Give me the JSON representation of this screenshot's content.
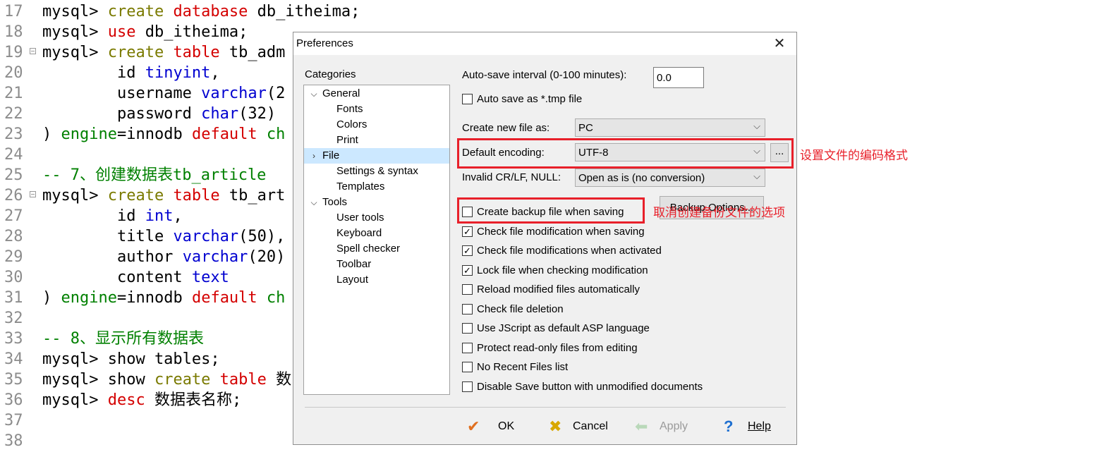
{
  "editor": {
    "lines": [
      {
        "n": "17",
        "fold": false,
        "tokens": [
          [
            "plain",
            "mysql> "
          ],
          [
            "kw2",
            "create "
          ],
          [
            "kw",
            "database "
          ],
          [
            "plain",
            "db_itheima;"
          ]
        ]
      },
      {
        "n": "18",
        "fold": false,
        "tokens": [
          [
            "plain",
            "mysql> "
          ],
          [
            "kw",
            "use "
          ],
          [
            "plain",
            "db_itheima;"
          ]
        ]
      },
      {
        "n": "19",
        "fold": true,
        "tokens": [
          [
            "plain",
            "mysql> "
          ],
          [
            "kw2",
            "create "
          ],
          [
            "kw",
            "table "
          ],
          [
            "plain",
            "tb_adm"
          ]
        ]
      },
      {
        "n": "20",
        "fold": false,
        "tokens": [
          [
            "plain",
            "        id "
          ],
          [
            "type",
            "tinyint"
          ],
          [
            "plain",
            ","
          ]
        ]
      },
      {
        "n": "21",
        "fold": false,
        "tokens": [
          [
            "plain",
            "        username "
          ],
          [
            "type",
            "varchar"
          ],
          [
            "plain",
            "(2"
          ]
        ]
      },
      {
        "n": "22",
        "fold": false,
        "tokens": [
          [
            "plain",
            "        password "
          ],
          [
            "type",
            "char"
          ],
          [
            "plain",
            "(32)"
          ]
        ]
      },
      {
        "n": "23",
        "fold": false,
        "tokens": [
          [
            "plain",
            ") "
          ],
          [
            "cm",
            "engine"
          ],
          [
            "plain",
            "=innodb "
          ],
          [
            "kw",
            "default "
          ],
          [
            "cm",
            "ch"
          ]
        ]
      },
      {
        "n": "24",
        "fold": false,
        "tokens": []
      },
      {
        "n": "25",
        "fold": false,
        "tokens": [
          [
            "cm",
            "-- 7、创建数据表tb_article"
          ]
        ]
      },
      {
        "n": "26",
        "fold": true,
        "tokens": [
          [
            "plain",
            "mysql> "
          ],
          [
            "kw2",
            "create "
          ],
          [
            "kw",
            "table "
          ],
          [
            "plain",
            "tb_art"
          ]
        ]
      },
      {
        "n": "27",
        "fold": false,
        "tokens": [
          [
            "plain",
            "        id "
          ],
          [
            "type",
            "int"
          ],
          [
            "plain",
            ","
          ]
        ]
      },
      {
        "n": "28",
        "fold": false,
        "tokens": [
          [
            "plain",
            "        title "
          ],
          [
            "type",
            "varchar"
          ],
          [
            "plain",
            "(50),"
          ]
        ]
      },
      {
        "n": "29",
        "fold": false,
        "tokens": [
          [
            "plain",
            "        author "
          ],
          [
            "type",
            "varchar"
          ],
          [
            "plain",
            "(20)"
          ]
        ]
      },
      {
        "n": "30",
        "fold": false,
        "tokens": [
          [
            "plain",
            "        content "
          ],
          [
            "type",
            "text"
          ]
        ]
      },
      {
        "n": "31",
        "fold": false,
        "tokens": [
          [
            "plain",
            ") "
          ],
          [
            "cm",
            "engine"
          ],
          [
            "plain",
            "=innodb "
          ],
          [
            "kw",
            "default "
          ],
          [
            "cm",
            "ch"
          ]
        ]
      },
      {
        "n": "32",
        "fold": false,
        "tokens": []
      },
      {
        "n": "33",
        "fold": false,
        "tokens": [
          [
            "cm",
            "-- 8、显示所有数据表"
          ]
        ]
      },
      {
        "n": "34",
        "fold": false,
        "tokens": [
          [
            "plain",
            "mysql> show tables;"
          ]
        ]
      },
      {
        "n": "35",
        "fold": false,
        "tokens": [
          [
            "plain",
            "mysql> show "
          ],
          [
            "kw2",
            "create "
          ],
          [
            "kw",
            "table "
          ],
          [
            "plain",
            "数"
          ]
        ]
      },
      {
        "n": "36",
        "fold": false,
        "tokens": [
          [
            "plain",
            "mysql> "
          ],
          [
            "kw",
            "desc "
          ],
          [
            "plain",
            "数据表名称;"
          ]
        ]
      },
      {
        "n": "37",
        "fold": false,
        "tokens": []
      },
      {
        "n": "38",
        "fold": false,
        "tokens": []
      }
    ]
  },
  "dialog": {
    "title": "Preferences",
    "close_glyph": "✕",
    "categories_label": "Categories",
    "tree": [
      {
        "label": "General",
        "level": 0,
        "expanded": true,
        "selected": false
      },
      {
        "label": "Fonts",
        "level": 1,
        "selected": false
      },
      {
        "label": "Colors",
        "level": 1,
        "selected": false
      },
      {
        "label": "Print",
        "level": 1,
        "selected": false
      },
      {
        "label": "File",
        "level": 0,
        "expanded": false,
        "selected": true
      },
      {
        "label": "Settings & syntax",
        "level": 1,
        "selected": false
      },
      {
        "label": "Templates",
        "level": 1,
        "selected": false
      },
      {
        "label": "Tools",
        "level": 0,
        "expanded": true,
        "selected": false
      },
      {
        "label": "User tools",
        "level": 1,
        "selected": false
      },
      {
        "label": "Keyboard",
        "level": 1,
        "selected": false
      },
      {
        "label": "Spell checker",
        "level": 1,
        "selected": false
      },
      {
        "label": "Toolbar",
        "level": 1,
        "selected": false
      },
      {
        "label": "Layout",
        "level": 1,
        "selected": false
      }
    ],
    "autosave_label": "Auto-save interval (0-100 minutes):",
    "autosave_value": "0.0",
    "autosave_tmp_label": "Auto save as *.tmp file",
    "create_new_label": "Create new file as:",
    "create_new_value": "PC",
    "encoding_label": "Default encoding:",
    "encoding_value": "UTF-8",
    "encoding_more": "...",
    "crlf_label": "Invalid CR/LF, NULL:",
    "crlf_value": "Open as is (no conversion)",
    "backup_options_label": "Backup Options...",
    "checkboxes": [
      {
        "label": "Create backup file when saving",
        "checked": false
      },
      {
        "label": "Check file modification when saving",
        "checked": true
      },
      {
        "label": "Check file modifications when activated",
        "checked": true
      },
      {
        "label": "Lock file when checking modification",
        "checked": true
      },
      {
        "label": "Reload modified files automatically",
        "checked": false
      },
      {
        "label": "Check file deletion",
        "checked": false
      },
      {
        "label": "Use JScript as default ASP language",
        "checked": false
      },
      {
        "label": "Protect read-only files from editing",
        "checked": false
      },
      {
        "label": "No Recent Files list",
        "checked": false
      },
      {
        "label": "Disable Save button with unmodified documents",
        "checked": false
      }
    ],
    "buttons": {
      "ok": "OK",
      "cancel": "Cancel",
      "apply": "Apply",
      "help": "Help"
    }
  },
  "annotations": {
    "encoding_note": "设置文件的编码格式",
    "backup_note": "取消创建备份文件的选项"
  },
  "colors": {
    "annotation_red": "#e8202a",
    "tree_selection": "#cce8ff",
    "ok_icon": "#e07020",
    "cancel_icon": "#d8a800",
    "apply_icon_disabled": "#b9d8b9",
    "help_icon": "#1e6fd0"
  },
  "icons": {
    "ok": "checkmark-icon",
    "cancel": "x-icon",
    "apply": "left-arrow-icon",
    "help": "question-icon",
    "dropdown": "chevron-down-icon"
  }
}
